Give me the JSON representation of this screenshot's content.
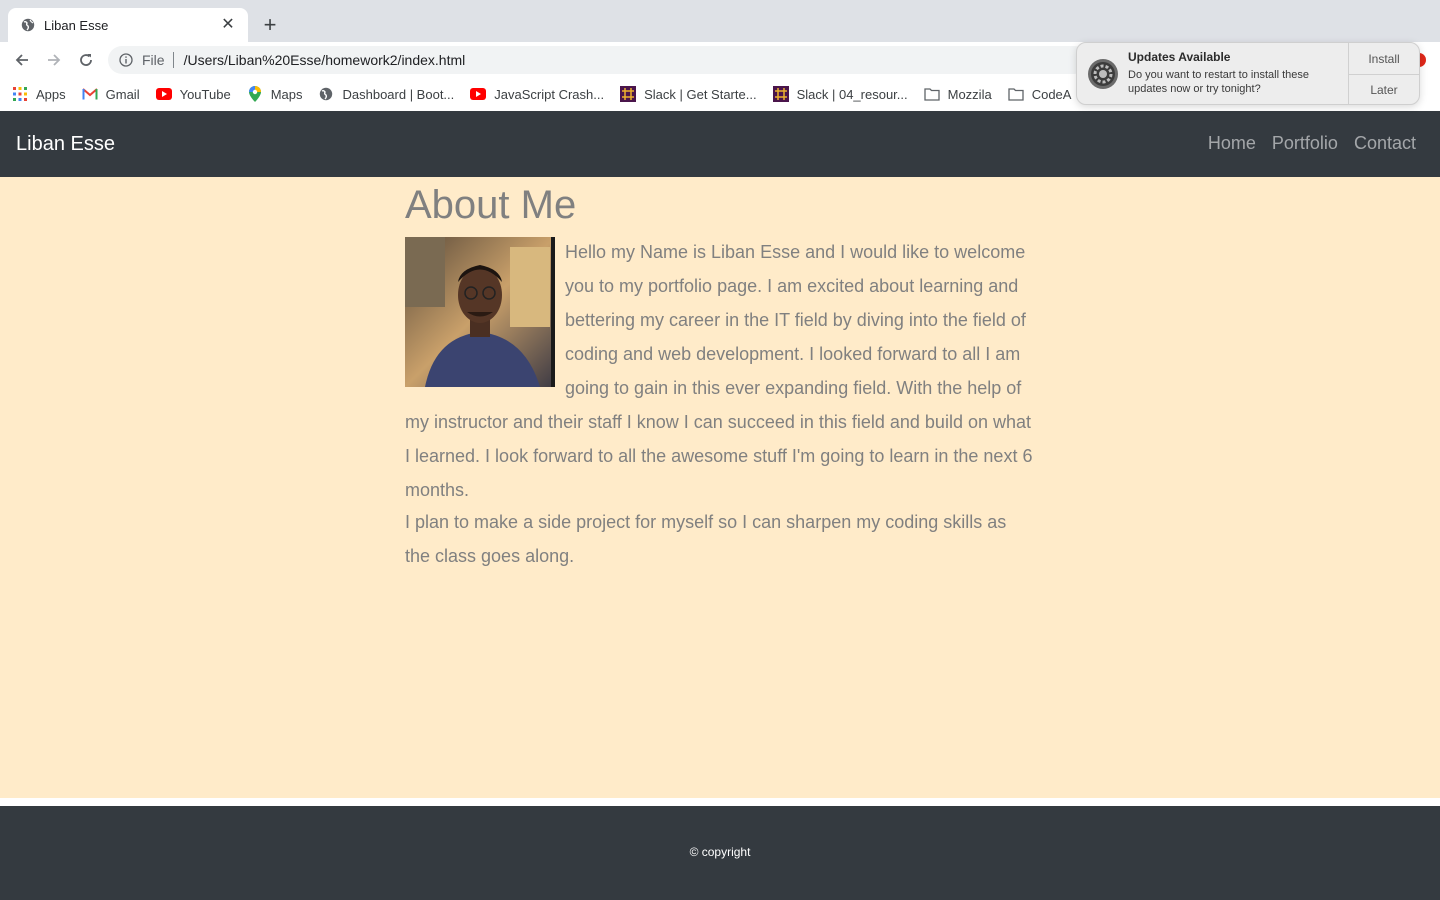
{
  "browser": {
    "tab_title": "Liban Esse",
    "omnibox": {
      "scheme": "File",
      "url": "/Users/Liban%20Esse/homework2/index.html"
    },
    "bookmarks": [
      {
        "label": "Apps",
        "icon": "apps-grid-icon"
      },
      {
        "label": "Gmail",
        "icon": "gmail-icon"
      },
      {
        "label": "YouTube",
        "icon": "youtube-icon"
      },
      {
        "label": "Maps",
        "icon": "maps-pin-icon"
      },
      {
        "label": "Dashboard | Boot...",
        "icon": "globe-icon"
      },
      {
        "label": "JavaScript Crash...",
        "icon": "youtube-icon"
      },
      {
        "label": "Slack | Get Starte...",
        "icon": "slack-icon"
      },
      {
        "label": "Slack | 04_resour...",
        "icon": "slack-icon"
      },
      {
        "label": "Mozzila",
        "icon": "folder-icon"
      },
      {
        "label": "CodeA",
        "icon": "folder-icon"
      }
    ]
  },
  "site": {
    "brand": "Liban Esse",
    "nav": [
      "Home",
      "Portfolio",
      "Contact"
    ],
    "heading": "About Me",
    "paragraph1": "Hello my Name is Liban Esse and I would like to welcome you to my portfolio page. I am excited about learning and bettering my career in the IT field by diving into the field of coding and web development. I looked forward to all I am going to gain in this ever expanding field. With the help of my instructor and their staff I know I can succeed in this field and build on what I learned. I look forward to all the awesome stuff I'm going to learn in the next 6 months.",
    "paragraph2": "I plan to make a side project for myself so I can sharpen my coding skills as the class goes along.",
    "footer": "© copyright",
    "colors": {
      "navbar": "#343a40",
      "main_background": "#ffebc9",
      "text": "#808080"
    }
  },
  "notification": {
    "title": "Updates Available",
    "body": "Do you want to restart to install these updates now or try tonight?",
    "install_label": "Install",
    "later_label": "Later"
  }
}
